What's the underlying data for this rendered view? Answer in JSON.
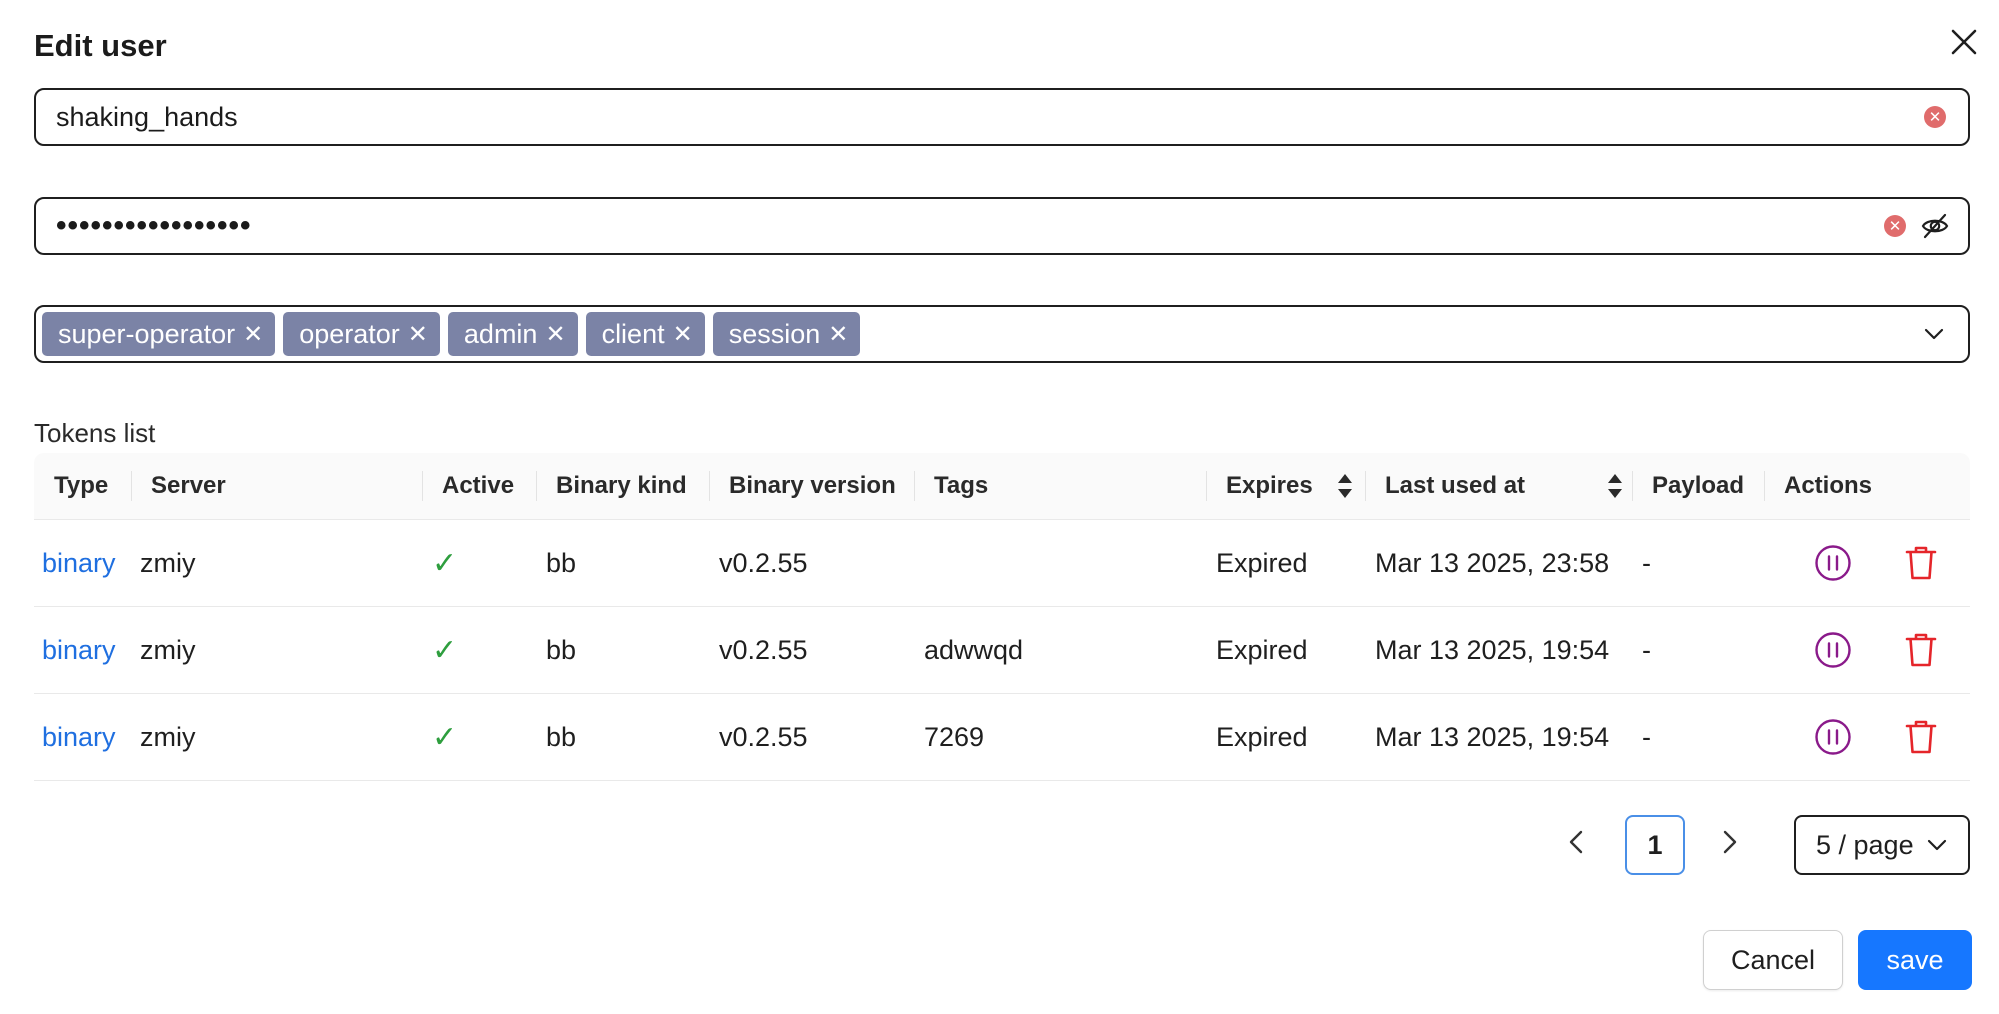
{
  "dialog": {
    "title": "Edit user"
  },
  "form": {
    "username": "shaking_hands",
    "password_mask": "•••••••••••••••••",
    "roles": [
      "super-operator",
      "operator",
      "admin",
      "client",
      "session"
    ]
  },
  "tokens": {
    "label": "Tokens list",
    "columns": {
      "type": "Type",
      "server": "Server",
      "active": "Active",
      "binary_kind": "Binary kind",
      "binary_version": "Binary version",
      "tags": "Tags",
      "expires": "Expires",
      "last_used_at": "Last used at",
      "payload": "Payload",
      "actions": "Actions"
    },
    "rows": [
      {
        "type": "binary",
        "server": "zmiy",
        "active": "✓",
        "binary_kind": "bb",
        "binary_version": "v0.2.55",
        "tags": "",
        "expires": "Expired",
        "last_used_at": "Mar 13 2025, 23:58",
        "payload": "-"
      },
      {
        "type": "binary",
        "server": "zmiy",
        "active": "✓",
        "binary_kind": "bb",
        "binary_version": "v0.2.55",
        "tags": "adwwqd",
        "expires": "Expired",
        "last_used_at": "Mar 13 2025, 19:54",
        "payload": "-"
      },
      {
        "type": "binary",
        "server": "zmiy",
        "active": "✓",
        "binary_kind": "bb",
        "binary_version": "v0.2.55",
        "tags": "7269",
        "expires": "Expired",
        "last_used_at": "Mar 13 2025, 19:54",
        "payload": "-"
      }
    ]
  },
  "pagination": {
    "current_page": "1",
    "page_size": "5 / page"
  },
  "footer": {
    "cancel_label": "Cancel",
    "save_label": "save"
  },
  "colors": {
    "link": "#1f6fe0",
    "active_check": "#2e9e3e",
    "pause_icon": "#8a1a8a",
    "delete_icon": "#e5252a",
    "primary": "#1677ff",
    "tag_bg": "#7b83a6"
  },
  "icons": {
    "close": "close-icon",
    "clear": "clear-icon",
    "eye_off": "eye-off-icon",
    "chevron": "chevron-down-icon",
    "pause": "pause-circle-icon",
    "delete": "trash-icon",
    "sort": "sort-icon"
  }
}
